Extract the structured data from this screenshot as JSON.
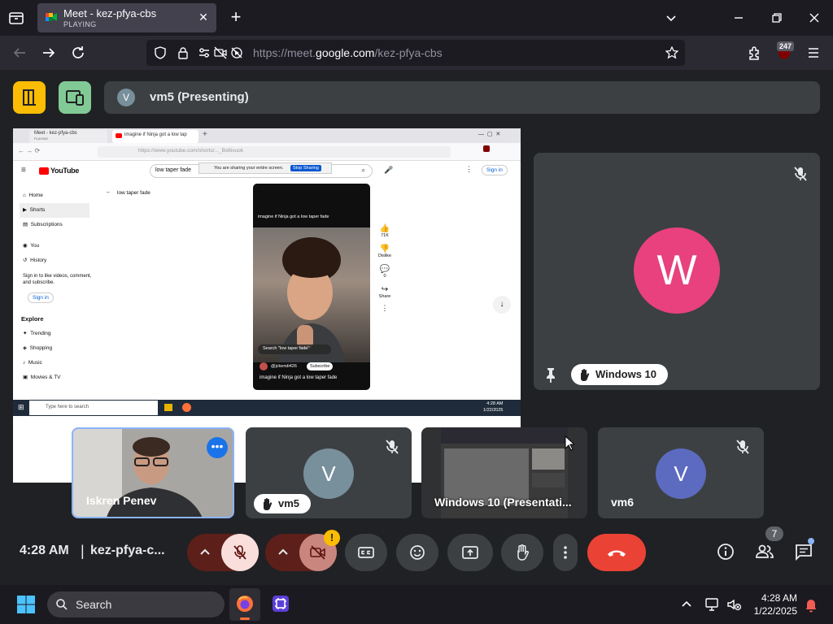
{
  "browser": {
    "tab": {
      "title": "Meet - kez-pfya-cbs",
      "status": "PLAYING"
    },
    "url_prefix": "https://meet.",
    "url_host": "google.com",
    "url_path": "/kez-pfya-cbs",
    "badge_count": "247"
  },
  "meet": {
    "presenting_avatar": "V",
    "presenting_label": "vm5 (Presenting)",
    "big_tile": {
      "avatar": "W",
      "avatar_color": "#e8417d",
      "name": "Windows 10"
    },
    "participants": [
      {
        "name": "Iskren Penev"
      },
      {
        "name": "vm5",
        "avatar": "V",
        "avatar_color": "#78909c"
      },
      {
        "name": "Windows 10 (Presentati..."
      },
      {
        "name": "vm6",
        "avatar": "V",
        "avatar_color": "#5c6bc0"
      }
    ],
    "controls": {
      "time": "4:28 AM",
      "separator": "|",
      "meeting_code": "kez-pfya-c...",
      "warning_badge": "!",
      "people_count": "7"
    }
  },
  "shared_screen": {
    "tab1": "Meet - kez-pfya-cbs",
    "tab1_sub": "PLAYING",
    "tab2": "imagine if Ninja got a low tap",
    "url": "https://www.youtube.com/shorts/..._Bs6ivuok",
    "logo": "YouTube",
    "search_value": "low taper fade",
    "sharing_notice": "You are sharing your entire screen.",
    "stop_sharing": "Stop Sharing",
    "sign_in_top": "Sign in",
    "nav": [
      "Home",
      "Shorts",
      "Subscriptions",
      "You",
      "History"
    ],
    "sign_in_prompt": "Sign in to like videos, comment, and subscribe.",
    "sign_in_side": "Sign in",
    "explore": "Explore",
    "explore_items": [
      "Trending",
      "Shopping",
      "Music",
      "Movies & TV"
    ],
    "back_label": "low taper fade",
    "short_caption": "imagine if Ninja got a low taper fade",
    "short_search": "Search \"low taper fade\"",
    "channel": "@jckendi426",
    "subscribe": "Subscribe",
    "likes": "71K",
    "dislike": "Dislike",
    "comments": "0",
    "share": "Share",
    "taskbar_search": "Type here to search",
    "taskbar_time": "4:28 AM",
    "taskbar_date": "1/22/2025"
  },
  "taskbar": {
    "search_label": "Search",
    "time": "4:28 AM",
    "date": "1/22/2025"
  },
  "colors": {
    "meet_bg": "#202124",
    "tile_bg": "#3c4043",
    "end_call": "#ea4335",
    "mic_off_bg": "#f9dedc",
    "accent_yellow": "#fbbc04",
    "accent_green": "#81c995"
  }
}
